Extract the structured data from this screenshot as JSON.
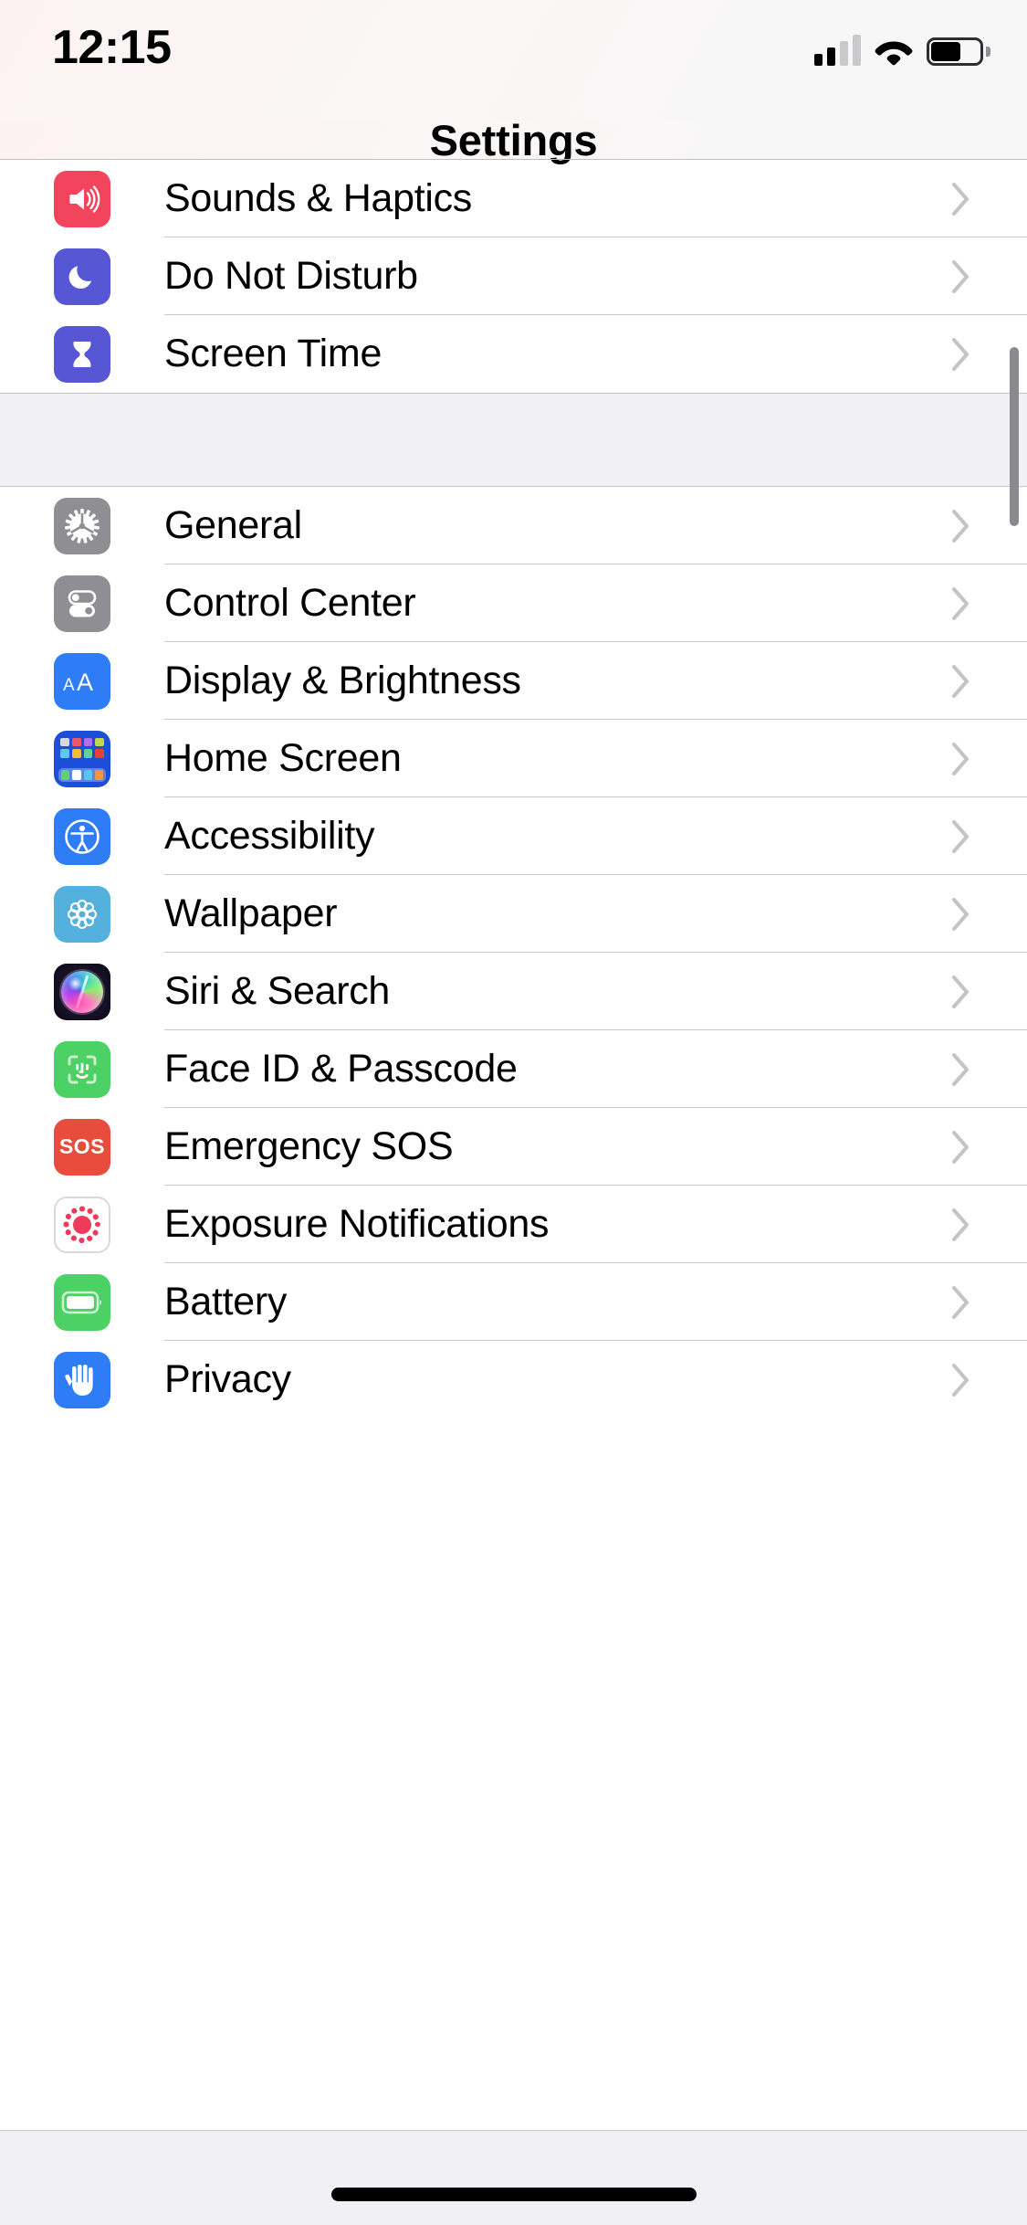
{
  "status_bar": {
    "time": "12:15",
    "cellular_icon": "cellular-signal-icon",
    "cellular_bars_filled": 2,
    "cellular_bars_total": 4,
    "wifi_icon": "wifi-icon",
    "battery_icon": "battery-icon",
    "battery_level_percent": 62
  },
  "nav": {
    "title": "Settings"
  },
  "groups": [
    {
      "rows": [
        {
          "label": "Sounds & Haptics",
          "icon": "speaker-waves-icon",
          "icon_color": "#F2445C",
          "chevron": "chevron-right-icon"
        },
        {
          "label": "Do Not Disturb",
          "icon": "moon-icon",
          "icon_color": "#5756D5",
          "chevron": "chevron-right-icon"
        },
        {
          "label": "Screen Time",
          "icon": "hourglass-icon",
          "icon_color": "#5756D5",
          "chevron": "chevron-right-icon"
        }
      ]
    },
    {
      "rows": [
        {
          "label": "General",
          "icon": "gear-icon",
          "icon_color": "#8E8E93",
          "chevron": "chevron-right-icon"
        },
        {
          "label": "Control Center",
          "icon": "toggles-icon",
          "icon_color": "#8E8E93",
          "chevron": "chevron-right-icon"
        },
        {
          "label": "Display & Brightness",
          "icon": "aa-text-size-icon",
          "icon_color": "#2E7CF6",
          "chevron": "chevron-right-icon"
        },
        {
          "label": "Home Screen",
          "icon": "app-grid-icon",
          "icon_color": "#1D4ED8",
          "chevron": "chevron-right-icon"
        },
        {
          "label": "Accessibility",
          "icon": "accessibility-icon",
          "icon_color": "#2E7CF6",
          "chevron": "chevron-right-icon"
        },
        {
          "label": "Wallpaper",
          "icon": "flower-icon",
          "icon_color": "#54B0DD",
          "chevron": "chevron-right-icon"
        },
        {
          "label": "Siri & Search",
          "icon": "siri-orb-icon",
          "icon_color": "#140F22",
          "chevron": "chevron-right-icon"
        },
        {
          "label": "Face ID & Passcode",
          "icon": "face-id-icon",
          "icon_color": "#4CD264",
          "chevron": "chevron-right-icon"
        },
        {
          "label": "Emergency SOS",
          "icon": "sos-icon",
          "icon_color": "#E74C3C",
          "icon_text": "SOS",
          "chevron": "chevron-right-icon"
        },
        {
          "label": "Exposure Notifications",
          "icon": "exposure-dots-icon",
          "icon_color": "#FFFFFF",
          "chevron": "chevron-right-icon"
        },
        {
          "label": "Battery",
          "icon": "battery-icon",
          "icon_color": "#4CD264",
          "chevron": "chevron-right-icon"
        },
        {
          "label": "Privacy",
          "icon": "hand-raised-icon",
          "icon_color": "#2E7CF6",
          "chevron": "chevron-right-icon"
        }
      ]
    }
  ],
  "scroll_indicator": {
    "name": "scroll-indicator"
  },
  "home_indicator": {
    "name": "home-indicator"
  },
  "theme": {
    "background": "#FFFFFF",
    "group_gap": "#F1F1F5",
    "separator": "#C8C7CC",
    "label_color": "#000000",
    "chevron_color": "#C4C4C6"
  }
}
